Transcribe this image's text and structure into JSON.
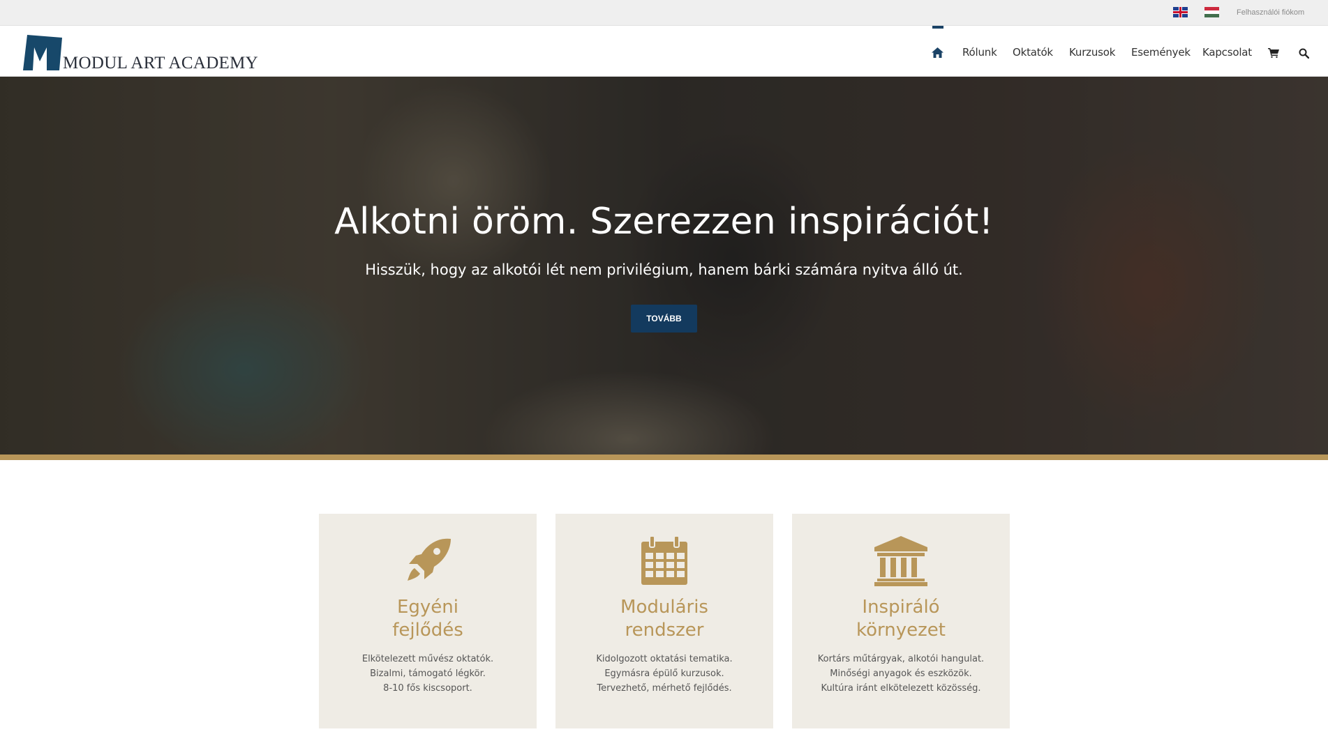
{
  "topbar": {
    "flags": [
      "english-flag",
      "hungarian-flag"
    ],
    "account_link": "Felhasználói fiókom"
  },
  "header": {
    "logo_text": "MODUL ART ACADEMY",
    "nav": {
      "home_icon": "home-icon",
      "items": [
        "Rólunk",
        "Oktatók",
        "Kurzusok",
        "Események",
        "Kapcsolat"
      ],
      "cart_icon": "cart-icon",
      "search_icon": "search-icon"
    }
  },
  "hero": {
    "title": "Alkotni öröm. Szerezzen inspirációt!",
    "subtitle": "Hisszük, hogy az alkotói lét nem privilégium, hanem bárki számára nyitva álló út.",
    "button": "TOVÁBB"
  },
  "features": [
    {
      "icon": "rocket-icon",
      "title_line1": "Egyéni",
      "title_line2": "fejlődés",
      "lines": [
        "Elkötelezett művész oktatók.",
        "Bizalmi, támogató légkör.",
        "8-10 fős kiscsoport."
      ]
    },
    {
      "icon": "calendar-icon",
      "title_line1": "Moduláris",
      "title_line2": "rendszer",
      "lines": [
        "Kidolgozott oktatási tematika.",
        "Egymásra épülő kurzusok.",
        "Tervezhető, mérhető fejlődés."
      ]
    },
    {
      "icon": "institution-icon",
      "title_line1": "Inspiráló",
      "title_line2": "környezet",
      "lines": [
        "Kortárs műtárgyak, alkotói hangulat.",
        "Minőségi anyagok és eszközök.",
        "Kultúra iránt elkötelezett közösség."
      ]
    }
  ],
  "colors": {
    "brand_blue": "#133a5e",
    "gold": "#b89659",
    "card_bg": "#efece5"
  }
}
